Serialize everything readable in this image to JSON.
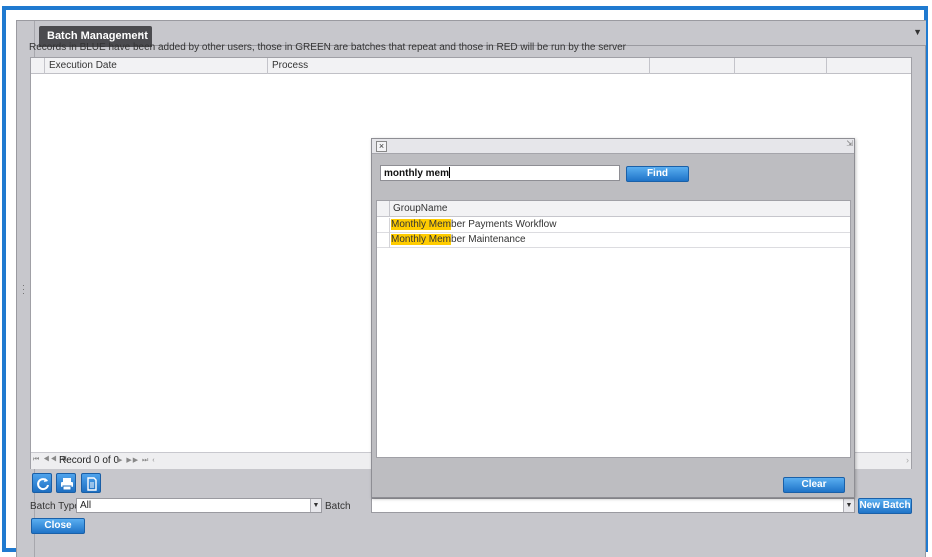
{
  "tab": {
    "title": "Batch Management",
    "close_glyph": "×",
    "menu_glyph": "▼"
  },
  "notice": "Records in BLUE have been added by other users, those in GREEN are batches that repeat and those in RED will be run by the server",
  "grid": {
    "columns": [
      "Execution Date",
      "Process",
      "",
      "",
      ""
    ],
    "pager_text": "Record 0 of 0",
    "pager_nav_left": "⏮ ◀◀ ◀",
    "pager_nav_right": "▶ ▶▶ ⏭ ‹",
    "scroll_glyph": "›"
  },
  "toolbar": {
    "icons": [
      "refresh-icon",
      "print-icon",
      "document-icon"
    ]
  },
  "filters": {
    "batch_type_label": "Batch Type",
    "batch_type_value": "All",
    "batch_label": "Batch",
    "batch_value": "",
    "dropdown_glyph": "▼"
  },
  "buttons": {
    "new_batch": "New Batch",
    "close": "Close",
    "find": "Find",
    "clear": "Clear"
  },
  "popup": {
    "close_glyph": "×",
    "resize_glyph": "⇲",
    "search_value": "monthly mem",
    "column": "GroupName",
    "results": [
      {
        "match": "Monthly Mem",
        "rest": "ber Payments Workflow"
      },
      {
        "match": "Monthly Mem",
        "rest": "ber Maintenance"
      }
    ]
  },
  "colors": {
    "accent": "#1f7ad0",
    "highlight": "#ffcc00",
    "tab_bg": "#4b4b4f"
  }
}
